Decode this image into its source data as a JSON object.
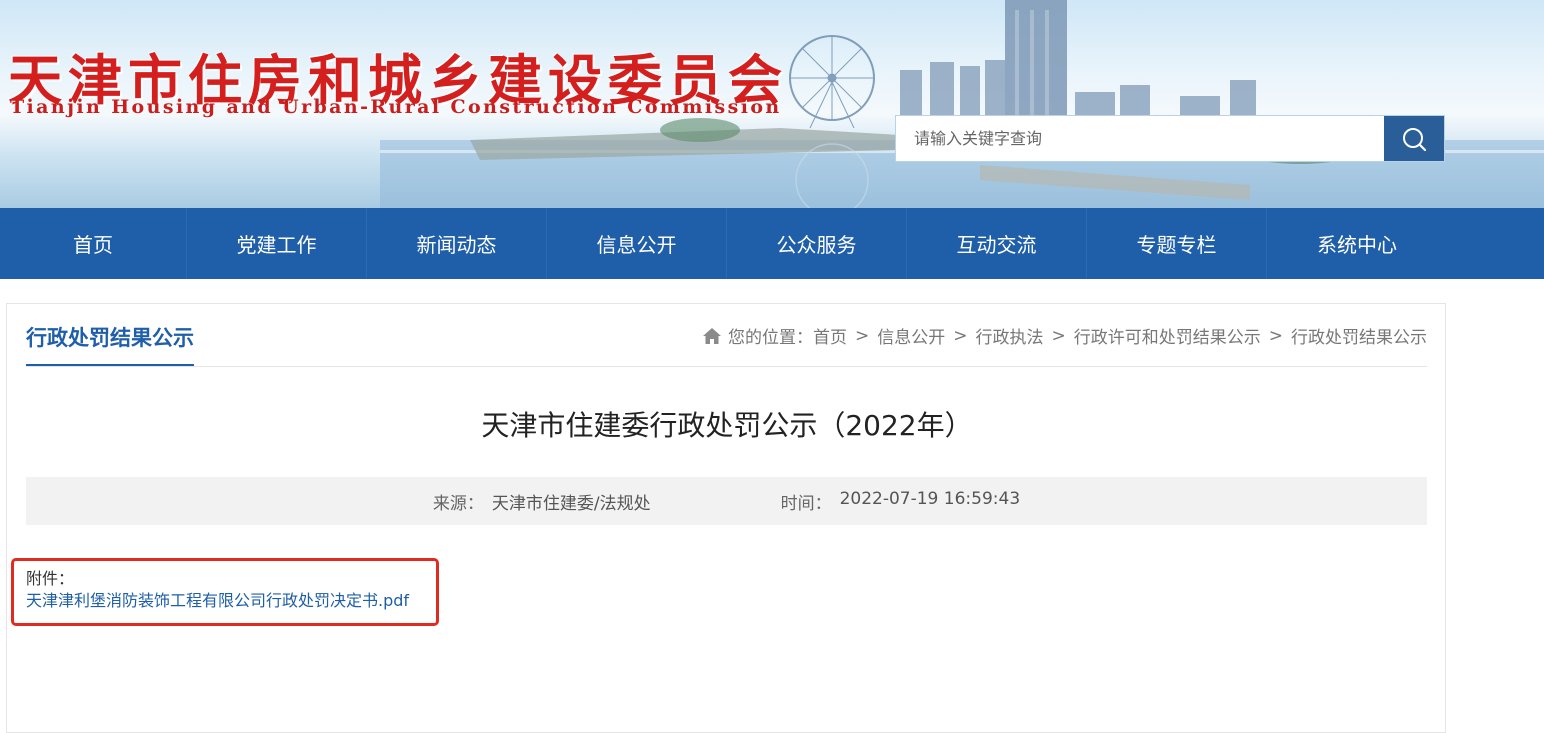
{
  "header": {
    "logo_cn": "天津市住房和城乡建设委员会",
    "logo_en": "Tianjin Housing and Urban-Rural Construction Commission",
    "search": {
      "placeholder": "请输入关键字查询",
      "icon": "search-icon"
    }
  },
  "nav": {
    "items": [
      {
        "label": "首页"
      },
      {
        "label": "党建工作"
      },
      {
        "label": "新闻动态"
      },
      {
        "label": "信息公开"
      },
      {
        "label": "公众服务"
      },
      {
        "label": "互动交流"
      },
      {
        "label": "专题专栏"
      },
      {
        "label": "系统中心"
      }
    ]
  },
  "section": {
    "title": "行政处罚结果公示"
  },
  "breadcrumb": {
    "icon": "home-icon",
    "prefix": "您的位置：",
    "items": [
      "首页",
      "信息公开",
      "行政执法",
      "行政许可和处罚结果公示",
      "行政处罚结果公示"
    ],
    "separator": ">"
  },
  "article": {
    "title": "天津市住建委行政处罚公示（2022年）",
    "source_label": "来源：",
    "source_value": "天津市住建委/法规处",
    "time_label": "时间：",
    "time_value": "2022-07-19 16:59:43",
    "attachment_label": "附件：",
    "attachment_link": "天津津利堡消防装饰工程有限公司行政处罚决定书.pdf"
  },
  "colors": {
    "brand_blue": "#1f5ea8",
    "logo_red": "#d41f1f",
    "highlight_red": "#e02b20"
  }
}
